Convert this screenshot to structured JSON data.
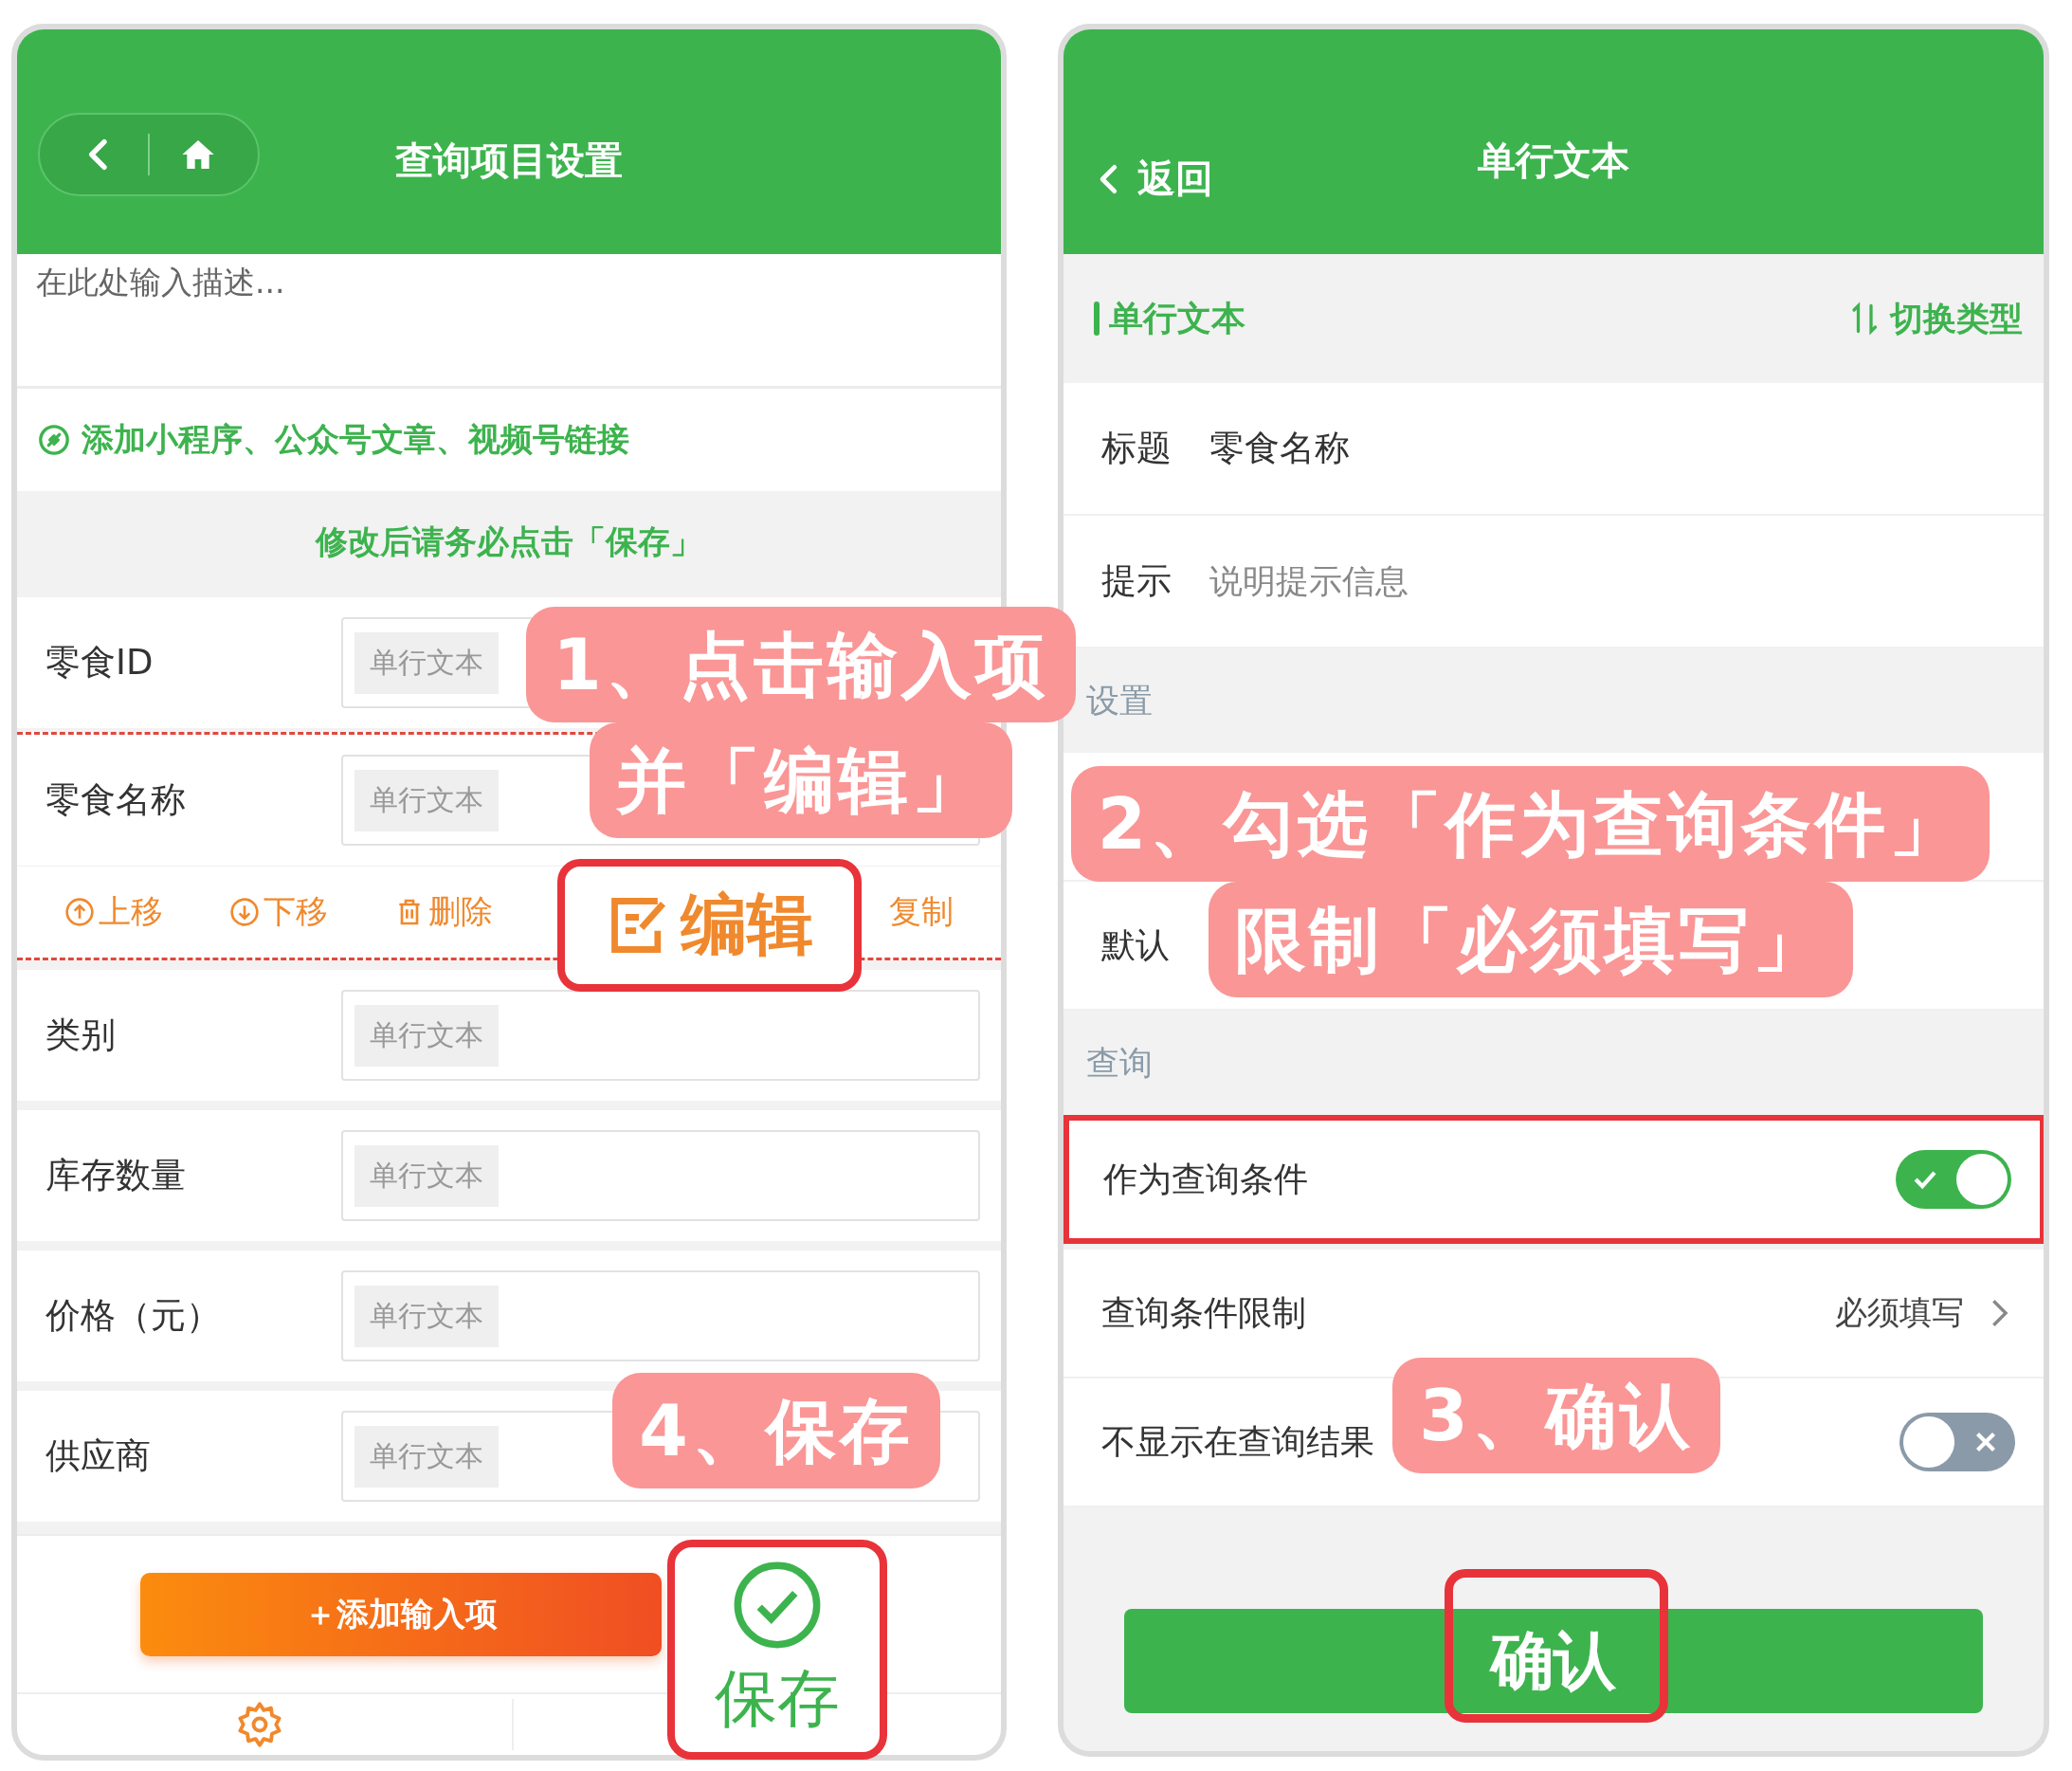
{
  "left_screen": {
    "title": "查询项目设置",
    "description_placeholder": "在此处输入描述...",
    "link": "添加小程序、公众号文章、视频号链接",
    "notice": "修改后请务必点击「保存」",
    "fields": [
      {
        "label": "零食ID",
        "placeholder": "单行文本",
        "selected": false
      },
      {
        "label": "零食名称",
        "placeholder": "单行文本",
        "selected": true
      },
      {
        "label": "类别",
        "placeholder": "单行文本",
        "selected": false
      },
      {
        "label": "库存数量",
        "placeholder": "单行文本",
        "selected": false
      },
      {
        "label": "价格（元）",
        "placeholder": "单行文本",
        "selected": false
      },
      {
        "label": "供应商",
        "placeholder": "单行文本",
        "selected": false
      }
    ],
    "actions": [
      {
        "kind": "up",
        "label": "上移"
      },
      {
        "kind": "down",
        "label": "下移"
      },
      {
        "kind": "delete",
        "label": "删除"
      },
      {
        "kind": "copy",
        "label": "复制"
      }
    ],
    "add_button": "＋添加输入项",
    "edit_button": "编辑",
    "save_button": "保存"
  },
  "right_screen": {
    "back": "返回",
    "title": "单行文本",
    "type_label": "单行文本",
    "switch_type": "切换类型",
    "title_row": {
      "label": "标题",
      "value": "零食名称"
    },
    "hint_row": {
      "label": "提示",
      "placeholder": "说明提示信息"
    },
    "sections": [
      {
        "heading": "设置",
        "rows": [
          {
            "kind": "text",
            "label": "默认",
            "highlighted": false
          }
        ]
      },
      {
        "heading": "查询",
        "rows": [
          {
            "kind": "toggle",
            "label": "作为查询条件",
            "on": true,
            "highlighted": true
          },
          {
            "kind": "link",
            "label": "查询条件限制",
            "value": "必须填写",
            "highlighted": false
          },
          {
            "kind": "toggle",
            "label": "不显示在查询结果",
            "on": false,
            "highlighted": false
          }
        ]
      }
    ],
    "confirm_button": "确认"
  },
  "callouts": [
    {
      "lines": [
        "1、点击输入项",
        "并「编辑」"
      ]
    },
    {
      "lines": [
        "2、勾选「作为查询条件」",
        "限制「必须填写」"
      ]
    },
    {
      "lines": [
        "3、确认"
      ]
    },
    {
      "lines": [
        "4、保存"
      ]
    }
  ]
}
